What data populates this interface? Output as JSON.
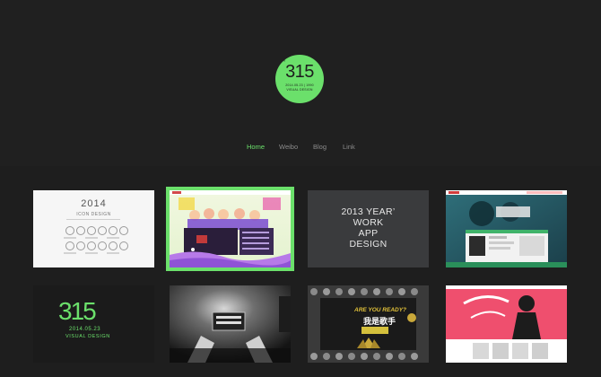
{
  "logo": {
    "number": "315",
    "degree": "°",
    "line1": "2014.05.23 | 1990",
    "line2": "VISUAL DESIGN"
  },
  "nav": {
    "items": [
      {
        "label": "Home",
        "active": true
      },
      {
        "label": "Weibo",
        "active": false
      },
      {
        "label": "Blog",
        "active": false
      },
      {
        "label": "Link",
        "active": false
      }
    ]
  },
  "tiles": {
    "t1": {
      "title": "2014",
      "subtitle": "ICON DESIGN"
    },
    "t3": {
      "line1": "2013 YEAR’",
      "line2": "WORK",
      "line3": "APP",
      "line4": "DESIGN"
    },
    "t5": {
      "number": "315",
      "degree": "°",
      "line1": "2014.05.23",
      "line2": "VISUAL DESIGN"
    },
    "t7": {
      "line1": "ARE YOU READY?",
      "line2": "我是歌手"
    }
  },
  "colors": {
    "accent": "#6be06b",
    "background": "#222222"
  }
}
